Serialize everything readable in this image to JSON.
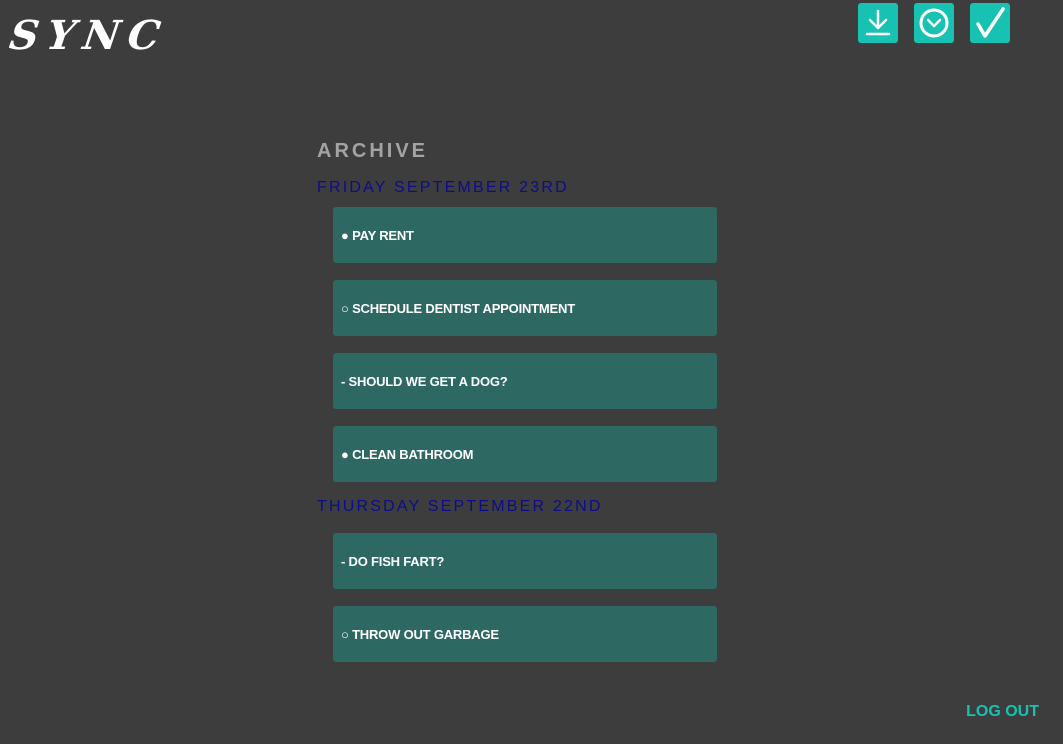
{
  "app": {
    "logo_text": "SYNC"
  },
  "toolbar": {
    "items": [
      {
        "icon": "download-icon"
      },
      {
        "icon": "clock-icon"
      },
      {
        "icon": "checkmark-icon"
      }
    ],
    "accent_color": "#17c2b3"
  },
  "archive": {
    "title": "ARCHIVE",
    "days": [
      {
        "heading": "FRIDAY SEPTEMBER 23RD",
        "tasks": [
          {
            "text": "● PAY RENT"
          },
          {
            "text": "○ SCHEDULE DENTIST APPOINTMENT"
          },
          {
            "text": "- SHOULD WE GET A DOG?"
          },
          {
            "text": "● CLEAN BATHROOM"
          }
        ]
      },
      {
        "heading": "THURSDAY SEPTEMBER 22ND",
        "tasks": [
          {
            "text": "- DO FISH FART?"
          },
          {
            "text": "○ THROW OUT GARBAGE"
          }
        ]
      }
    ]
  },
  "footer": {
    "logout_label": "LOG OUT"
  },
  "colors": {
    "background": "#3d3d3d",
    "card": "#2d6863",
    "day_heading": "#0c0c8c",
    "archive_title": "#a3a3a3"
  }
}
